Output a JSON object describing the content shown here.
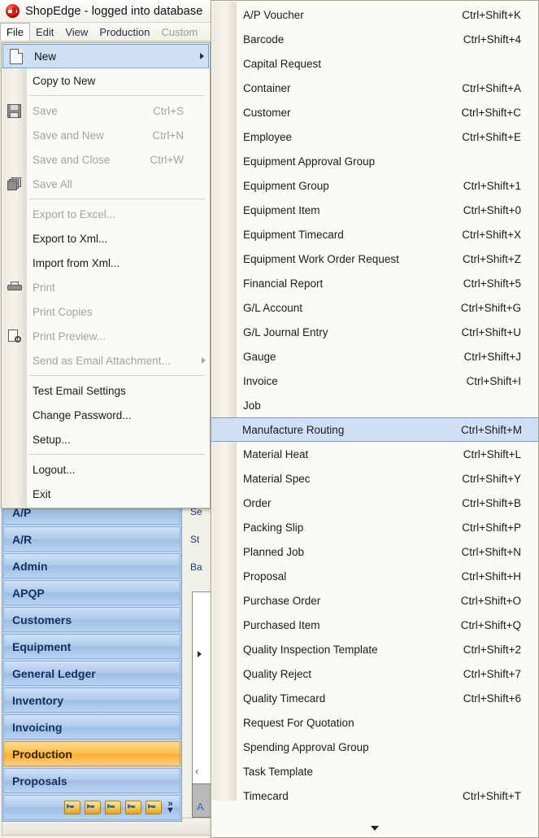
{
  "window": {
    "title": "ShopEdge -  logged into database",
    "logo_icon": "shopedge-logo"
  },
  "menubar": {
    "items": [
      {
        "label": "File",
        "state": "open"
      },
      {
        "label": "Edit",
        "state": "normal"
      },
      {
        "label": "View",
        "state": "normal"
      },
      {
        "label": "Production",
        "state": "normal"
      },
      {
        "label": "Custom",
        "state": "dimmed"
      }
    ]
  },
  "file_menu": {
    "rows": [
      {
        "type": "item",
        "label": "New",
        "shortcut": "",
        "icon": "new-document-icon",
        "enabled": true,
        "selected": true,
        "submenu": true
      },
      {
        "type": "item",
        "label": "Copy to New",
        "shortcut": "",
        "icon": "",
        "enabled": true,
        "selected": false,
        "submenu": false
      },
      {
        "type": "separator"
      },
      {
        "type": "item",
        "label": "Save",
        "shortcut": "Ctrl+S",
        "icon": "save-floppy-icon",
        "enabled": false,
        "selected": false,
        "submenu": false
      },
      {
        "type": "item",
        "label": "Save and New",
        "shortcut": "Ctrl+N",
        "icon": "",
        "enabled": false,
        "selected": false,
        "submenu": false
      },
      {
        "type": "item",
        "label": "Save and Close",
        "shortcut": "Ctrl+W",
        "icon": "",
        "enabled": false,
        "selected": false,
        "submenu": false
      },
      {
        "type": "item",
        "label": "Save All",
        "shortcut": "",
        "icon": "save-all-icon",
        "enabled": false,
        "selected": false,
        "submenu": false
      },
      {
        "type": "separator"
      },
      {
        "type": "item",
        "label": "Export to Excel...",
        "shortcut": "",
        "icon": "",
        "enabled": false,
        "selected": false,
        "submenu": false
      },
      {
        "type": "item",
        "label": "Export to Xml...",
        "shortcut": "",
        "icon": "",
        "enabled": true,
        "selected": false,
        "submenu": false
      },
      {
        "type": "item",
        "label": "Import from Xml...",
        "shortcut": "",
        "icon": "",
        "enabled": true,
        "selected": false,
        "submenu": false
      },
      {
        "type": "item",
        "label": "Print",
        "shortcut": "",
        "icon": "printer-icon",
        "enabled": false,
        "selected": false,
        "submenu": false
      },
      {
        "type": "item",
        "label": "Print Copies",
        "shortcut": "",
        "icon": "",
        "enabled": false,
        "selected": false,
        "submenu": false
      },
      {
        "type": "item",
        "label": "Print Preview...",
        "shortcut": "",
        "icon": "print-preview-icon",
        "enabled": false,
        "selected": false,
        "submenu": false
      },
      {
        "type": "item",
        "label": "Send as Email Attachment...",
        "shortcut": "",
        "icon": "",
        "enabled": false,
        "selected": false,
        "submenu": true
      },
      {
        "type": "separator"
      },
      {
        "type": "item",
        "label": "Test Email Settings",
        "shortcut": "",
        "icon": "",
        "enabled": true,
        "selected": false,
        "submenu": false
      },
      {
        "type": "item",
        "label": "Change Password...",
        "shortcut": "",
        "icon": "",
        "enabled": true,
        "selected": false,
        "submenu": false
      },
      {
        "type": "item",
        "label": "Setup...",
        "shortcut": "",
        "icon": "",
        "enabled": true,
        "selected": false,
        "submenu": false
      },
      {
        "type": "separator"
      },
      {
        "type": "item",
        "label": "Logout...",
        "shortcut": "",
        "icon": "",
        "enabled": true,
        "selected": false,
        "submenu": false
      },
      {
        "type": "item",
        "label": "Exit",
        "shortcut": "",
        "icon": "",
        "enabled": true,
        "selected": false,
        "submenu": false
      }
    ]
  },
  "new_submenu": {
    "scroll_down_icon": "scroll-down-arrow",
    "items": [
      {
        "label": "A/P Voucher",
        "shortcut": "Ctrl+Shift+K",
        "selected": false
      },
      {
        "label": "Barcode",
        "shortcut": "Ctrl+Shift+4",
        "selected": false
      },
      {
        "label": "Capital Request",
        "shortcut": "",
        "selected": false
      },
      {
        "label": "Container",
        "shortcut": "Ctrl+Shift+A",
        "selected": false
      },
      {
        "label": "Customer",
        "shortcut": "Ctrl+Shift+C",
        "selected": false
      },
      {
        "label": "Employee",
        "shortcut": "Ctrl+Shift+E",
        "selected": false
      },
      {
        "label": "Equipment Approval Group",
        "shortcut": "",
        "selected": false
      },
      {
        "label": "Equipment Group",
        "shortcut": "Ctrl+Shift+1",
        "selected": false
      },
      {
        "label": "Equipment Item",
        "shortcut": "Ctrl+Shift+0",
        "selected": false
      },
      {
        "label": "Equipment Timecard",
        "shortcut": "Ctrl+Shift+X",
        "selected": false
      },
      {
        "label": "Equipment Work Order Request",
        "shortcut": "Ctrl+Shift+Z",
        "selected": false
      },
      {
        "label": "Financial Report",
        "shortcut": "Ctrl+Shift+5",
        "selected": false
      },
      {
        "label": "G/L Account",
        "shortcut": "Ctrl+Shift+G",
        "selected": false
      },
      {
        "label": "G/L Journal Entry",
        "shortcut": "Ctrl+Shift+U",
        "selected": false
      },
      {
        "label": "Gauge",
        "shortcut": "Ctrl+Shift+J",
        "selected": false
      },
      {
        "label": "Invoice",
        "shortcut": "Ctrl+Shift+I",
        "selected": false
      },
      {
        "label": "Job",
        "shortcut": "",
        "selected": false
      },
      {
        "label": "Manufacture Routing",
        "shortcut": "Ctrl+Shift+M",
        "selected": true
      },
      {
        "label": "Material Heat",
        "shortcut": "Ctrl+Shift+L",
        "selected": false
      },
      {
        "label": "Material Spec",
        "shortcut": "Ctrl+Shift+Y",
        "selected": false
      },
      {
        "label": "Order",
        "shortcut": "Ctrl+Shift+B",
        "selected": false
      },
      {
        "label": "Packing Slip",
        "shortcut": "Ctrl+Shift+P",
        "selected": false
      },
      {
        "label": "Planned Job",
        "shortcut": "Ctrl+Shift+N",
        "selected": false
      },
      {
        "label": "Proposal",
        "shortcut": "Ctrl+Shift+H",
        "selected": false
      },
      {
        "label": "Purchase Order",
        "shortcut": "Ctrl+Shift+O",
        "selected": false
      },
      {
        "label": "Purchased Item",
        "shortcut": "Ctrl+Shift+Q",
        "selected": false
      },
      {
        "label": "Quality Inspection Template",
        "shortcut": "Ctrl+Shift+2",
        "selected": false
      },
      {
        "label": "Quality Reject",
        "shortcut": "Ctrl+Shift+7",
        "selected": false
      },
      {
        "label": "Quality Timecard",
        "shortcut": "Ctrl+Shift+6",
        "selected": false
      },
      {
        "label": "Request For Quotation",
        "shortcut": "",
        "selected": false
      },
      {
        "label": "Spending Approval Group",
        "shortcut": "",
        "selected": false
      },
      {
        "label": "Task Template",
        "shortcut": "",
        "selected": false
      },
      {
        "label": "Timecard",
        "shortcut": "Ctrl+Shift+T",
        "selected": false
      }
    ]
  },
  "navbar": {
    "items": [
      {
        "label": "A/P",
        "active": false
      },
      {
        "label": "A/R",
        "active": false
      },
      {
        "label": "Admin",
        "active": false
      },
      {
        "label": "APQP",
        "active": false
      },
      {
        "label": "Customers",
        "active": false
      },
      {
        "label": "Equipment",
        "active": false
      },
      {
        "label": "General Ledger",
        "active": false
      },
      {
        "label": "Inventory",
        "active": false
      },
      {
        "label": "Invoicing",
        "active": false
      },
      {
        "label": "Production",
        "active": true
      },
      {
        "label": "Proposals",
        "active": false
      }
    ],
    "folder_icon_count": 5,
    "overflow_icon": "double-chevron-down-icon"
  },
  "background_panel": {
    "labels": [
      "Se",
      "St",
      "Ba"
    ],
    "tab_label": "A",
    "collapse_icon": "collapse-left-icon",
    "expand_icon": "expand-right-icon"
  },
  "colors": {
    "accent_selected": "#cfe0f5",
    "accent_border": "#6f9fd8",
    "nav_active": "#f8ae2e",
    "nav_normal": "#aecaeb"
  }
}
